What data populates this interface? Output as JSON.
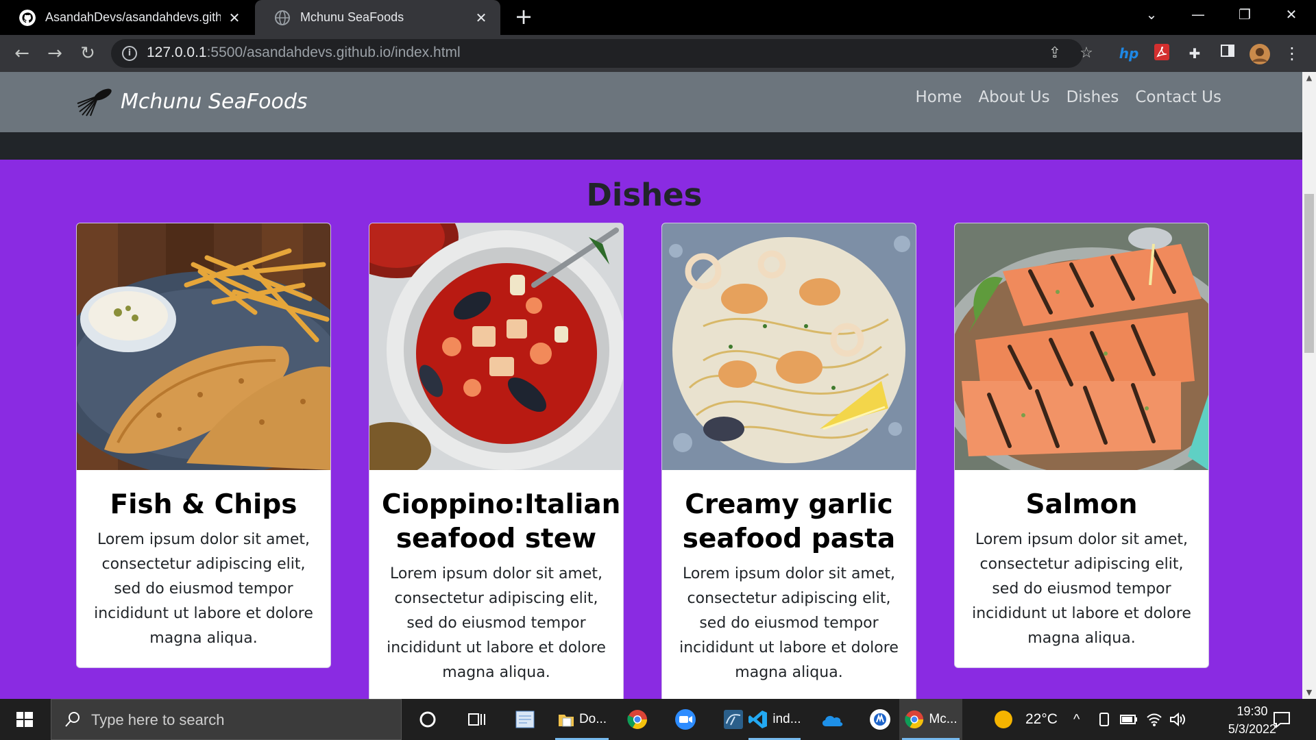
{
  "browser": {
    "tabs": [
      {
        "title": "AsandahDevs/asandahdevs.githu",
        "icon": "github-icon",
        "active": false
      },
      {
        "title": "Mchunu SeaFoods",
        "icon": "globe-icon",
        "active": true
      }
    ],
    "new_tab": "+",
    "url_host": "127.0.0.1",
    "url_path": ":5500/asandahdevs.github.io/index.html"
  },
  "site": {
    "brand": "Mchunu SeaFoods",
    "nav": [
      "Home",
      "About Us",
      "Dishes",
      "Contact Us"
    ],
    "section_title": "Dishes",
    "cards": [
      {
        "title": "Fish & Chips",
        "text": "Lorem ipsum dolor sit amet, consectetur adipiscing elit, sed do eiusmod tempor incididunt ut labore et dolore magna aliqua."
      },
      {
        "title": "Cioppino:Italian seafood stew",
        "text": "Lorem ipsum dolor sit amet, consectetur adipiscing elit, sed do eiusmod tempor incididunt ut labore et dolore magna aliqua."
      },
      {
        "title": "Creamy garlic seafood pasta",
        "text": "Lorem ipsum dolor sit amet, consectetur adipiscing elit, sed do eiusmod tempor incididunt ut labore et dolore magna aliqua."
      },
      {
        "title": "Salmon",
        "text": "Lorem ipsum dolor sit amet, consectetur adipiscing elit, sed do eiusmod tempor incididunt ut labore et dolore magna aliqua."
      }
    ],
    "colors": {
      "page_bg": "#8a2be2",
      "navbar_bg": "#6c757d",
      "hero_bg": "#212529"
    }
  },
  "taskbar": {
    "search_placeholder": "Type here to search",
    "apps": [
      {
        "name": "cortana-icon",
        "label": ""
      },
      {
        "name": "task-view-icon",
        "label": ""
      },
      {
        "name": "notepad-icon",
        "label": ""
      },
      {
        "name": "file-explorer-icon",
        "label": "Do..."
      },
      {
        "name": "chrome-icon",
        "label": ""
      },
      {
        "name": "zoom-icon",
        "label": ""
      },
      {
        "name": "mysql-workbench-icon",
        "label": ""
      },
      {
        "name": "vscode-icon",
        "label": "ind..."
      },
      {
        "name": "onedrive-icon",
        "label": ""
      },
      {
        "name": "app-icon",
        "label": ""
      },
      {
        "name": "chrome-active-icon",
        "label": "Mc..."
      }
    ],
    "weather": "22°C",
    "time": "19:30",
    "date": "5/3/2022"
  }
}
